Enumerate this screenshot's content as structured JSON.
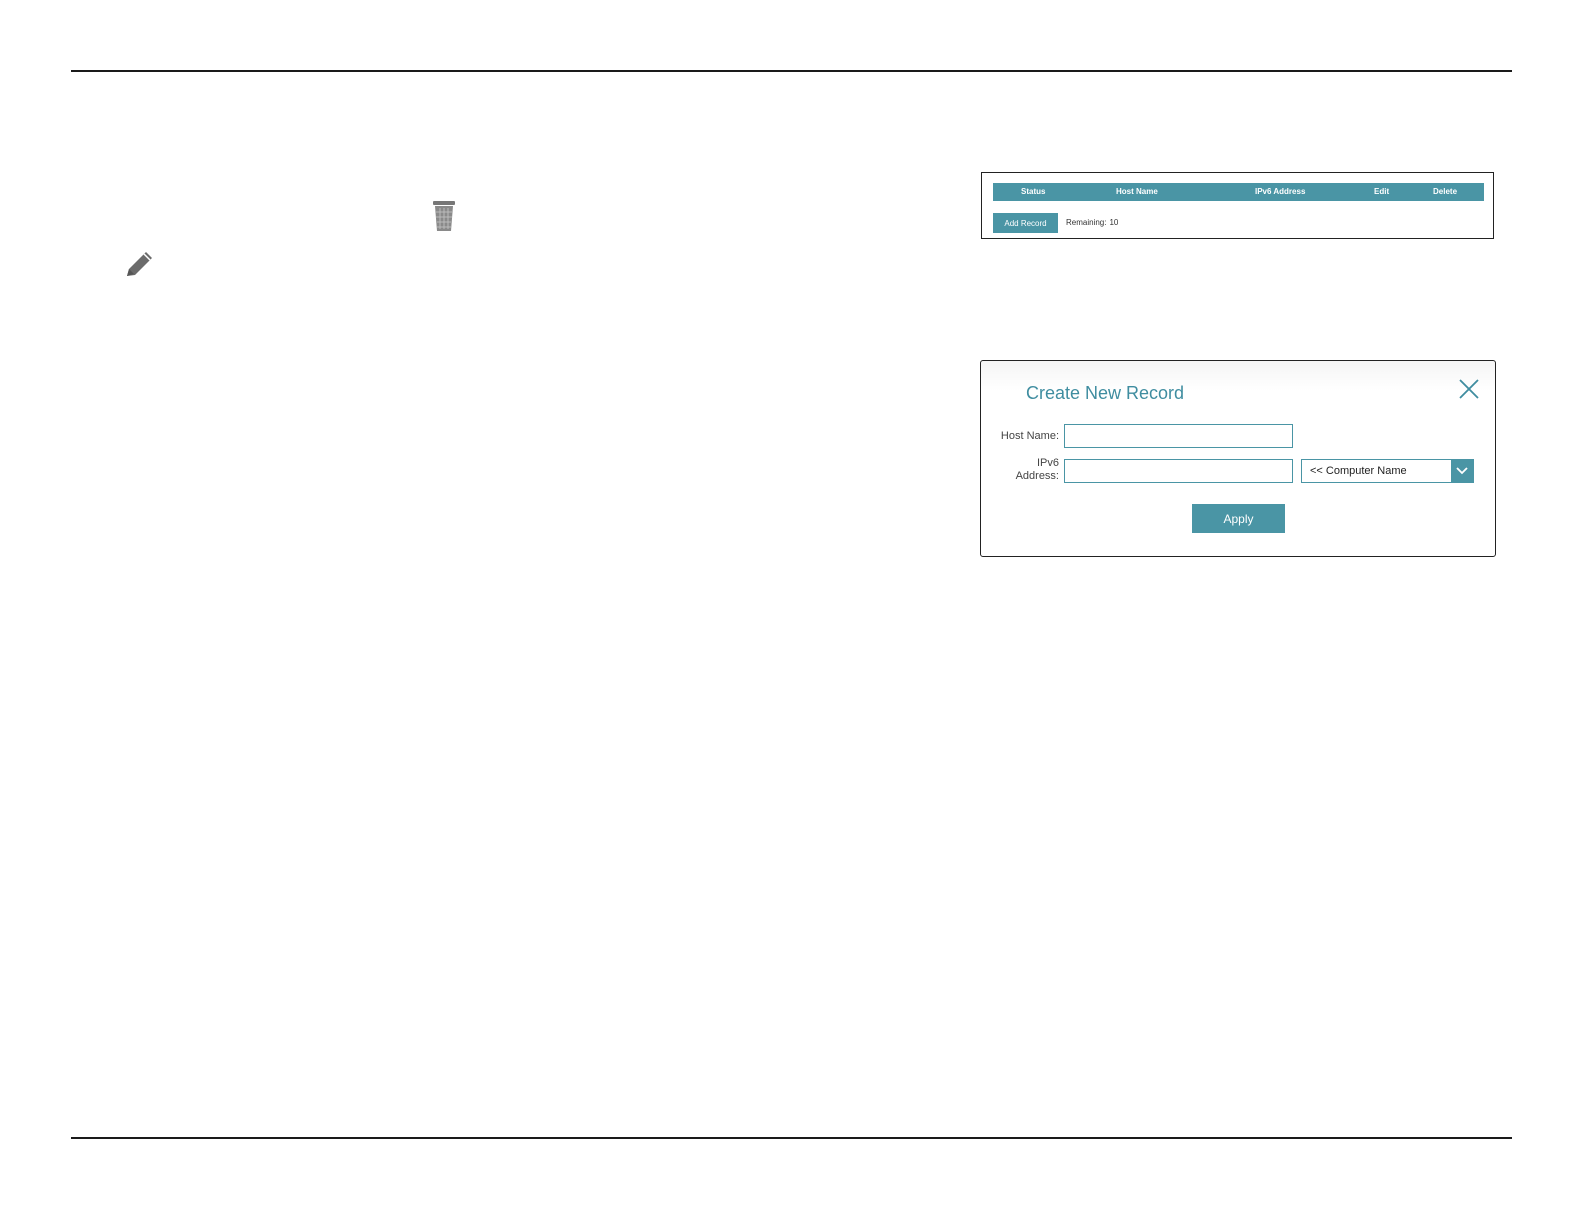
{
  "records_table": {
    "columns": [
      "Status",
      "Host Name",
      "IPv6 Address",
      "Edit",
      "Delete"
    ],
    "add_record_label": "Add Record",
    "remaining_label": "Remaining:",
    "remaining_value": "10"
  },
  "dialog": {
    "title": "Create New Record",
    "host_name_label": "Host Name:",
    "host_name_value": "",
    "ipv6_label_line1": "IPv6",
    "ipv6_label_line2": "Address:",
    "ipv6_value": "",
    "computer_select_value": "<< Computer Name",
    "apply_label": "Apply"
  },
  "icons": {
    "delete": "trash-icon",
    "edit": "pencil-icon",
    "close": "close-icon",
    "dropdown": "chevron-down-icon"
  },
  "colors": {
    "accent": "#4a95a5",
    "title": "#3f8da0",
    "rule": "#1a1a1a"
  }
}
